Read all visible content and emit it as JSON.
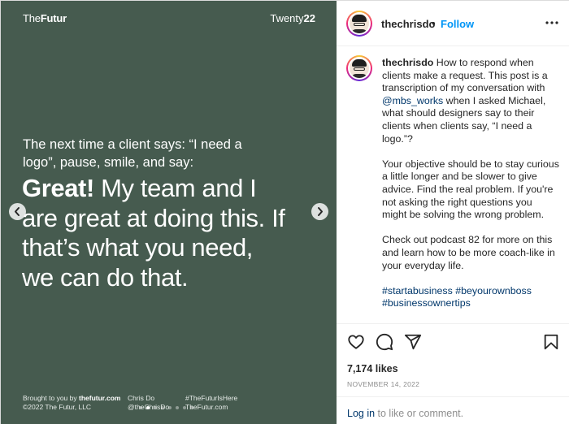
{
  "media": {
    "brand_left_prefix": "The",
    "brand_left_bold": "Futur",
    "brand_right_prefix": "Twenty",
    "brand_right_bold": "22",
    "lead": "The next time a client says: “I need a logo”, pause, smile, and say:",
    "headline_bold": "Great!",
    "headline_rest": " My team and I are great at doing this. If that’s what you need, we can do that.",
    "prev_arrow_icon": "chevron-left-icon",
    "next_arrow_icon": "chevron-right-icon",
    "footer": {
      "col1_line1_prefix": "Brought to you by ",
      "col1_line1_bold": "thefutur.com",
      "col1_line2": "©2022 The Futur, LLC",
      "col2_line1": "Chris Do",
      "col2_line2": "@theChrisDo",
      "col3_line1": "#TheFuturIsHere",
      "col3_line2": "TheFutur.com"
    },
    "carousel": {
      "total": 8,
      "active_index": 1
    },
    "background_color": "#465b4f"
  },
  "header": {
    "username": "thechrisdo",
    "separator": "•",
    "follow_label": "Follow",
    "more_icon": "more-horizontal-icon"
  },
  "caption": {
    "username": "thechrisdo",
    "p1_text_a": " How to respond when clients make a request. This post is a transcription of my conversation with ",
    "p1_mention": "@mbs_works",
    "p1_text_b": " when I asked Michael, what should designers say to their clients when clients say, “I need a logo.”?",
    "p2": "Your objective should be to stay curious a little longer and be slower to give advice. Find the real problem. If you're not asking the right questions you might be solving the wrong problem.",
    "p3": "Check out podcast 82 for more on this and learn how to be more coach-like in your everyday life.",
    "hashtags_line1": "#startabusiness #beyourownboss",
    "hashtags_line2": "#businessownertips"
  },
  "actions": {
    "like_icon": "heart-icon",
    "comment_icon": "comment-icon",
    "share_icon": "share-icon",
    "save_icon": "bookmark-icon",
    "likes": "7,174 likes",
    "date": "NOVEMBER 14, 2022",
    "login_label": "Log in",
    "comment_prompt_rest": " to like or comment."
  },
  "colors": {
    "accent": "#0095f6",
    "link": "#00376b",
    "muted": "#8e8e8e"
  }
}
